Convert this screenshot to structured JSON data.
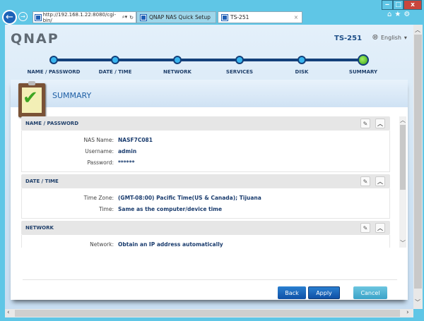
{
  "browser": {
    "address": "http://192.168.1.22:8080/cgi-bin/",
    "tabs": [
      {
        "label": "QNAP NAS Quick Setup"
      },
      {
        "label": "TS-251"
      }
    ],
    "window_controls": {
      "minimize": "‒",
      "maximize": "□",
      "close": "x"
    }
  },
  "header": {
    "logo": "QNAP",
    "model": "TS-251",
    "language": "English"
  },
  "steps": [
    {
      "label": "NAME / PASSWORD"
    },
    {
      "label": "DATE / TIME"
    },
    {
      "label": "NETWORK"
    },
    {
      "label": "SERVICES"
    },
    {
      "label": "DISK"
    },
    {
      "label": "SUMMARY"
    }
  ],
  "panel": {
    "title": "SUMMARY"
  },
  "sections": [
    {
      "title": "NAME / PASSWORD",
      "rows": [
        {
          "k": "NAS Name:",
          "v": "NASF7C081"
        },
        {
          "k": "Username:",
          "v": "admin"
        },
        {
          "k": "Password:",
          "v": "******"
        }
      ]
    },
    {
      "title": "DATE / TIME",
      "rows": [
        {
          "k": "Time Zone:",
          "v": "(GMT-08:00) Pacific Time(US & Canada); Tijuana"
        },
        {
          "k": "Time:",
          "v": "Same as the computer/device time"
        }
      ]
    },
    {
      "title": "NETWORK",
      "rows": [
        {
          "k": "Network:",
          "v": "Obtain an IP address automatically"
        }
      ]
    }
  ],
  "buttons": {
    "back": "Back",
    "apply": "Apply",
    "cancel": "Cancel"
  },
  "colors": {
    "accent": "#1f5fb5",
    "frame": "#5fc6e6",
    "active_step": "#3aa51a"
  }
}
